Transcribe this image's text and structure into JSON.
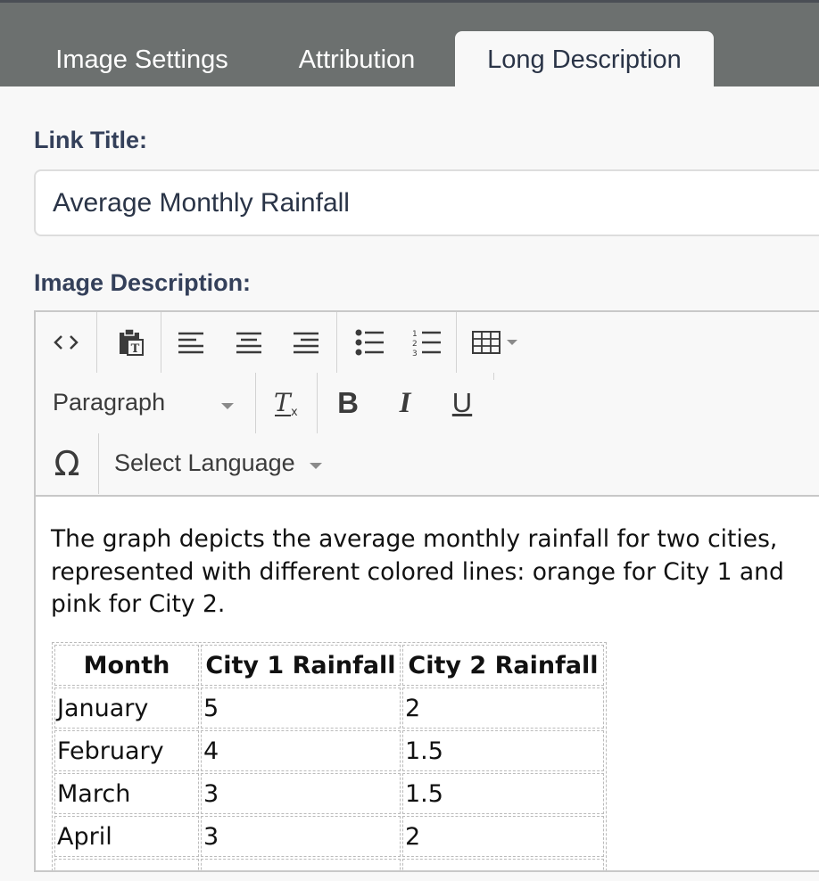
{
  "tabs": [
    {
      "label": "Image Settings",
      "active": false
    },
    {
      "label": "Attribution",
      "active": false
    },
    {
      "label": "Long Description",
      "active": true
    }
  ],
  "link_title": {
    "label": "Link Title:",
    "value": "Average Monthly Rainfall"
  },
  "image_description": {
    "label": "Image Description:"
  },
  "toolbar": {
    "format_select": "Paragraph",
    "language_select": "Select Language",
    "icons": [
      "source-code-icon",
      "paste-as-text-icon",
      "align-left-icon",
      "align-center-icon",
      "align-right-icon",
      "bullet-list-icon",
      "numbered-list-icon",
      "table-icon",
      "clear-formatting-icon",
      "bold-icon",
      "italic-icon",
      "underline-icon",
      "special-character-icon"
    ]
  },
  "content": {
    "paragraph": "The graph depicts the average monthly rainfall for two cities, represented with different colored lines: orange for City 1 and pink for City 2.",
    "table": {
      "headers": [
        "Month",
        "City 1 Rainfall",
        "City 2 Rainfall"
      ],
      "rows": [
        [
          "January",
          "5",
          "2"
        ],
        [
          "February",
          "4",
          "1.5"
        ],
        [
          "March",
          "3",
          "1.5"
        ],
        [
          "April",
          "3",
          "2"
        ],
        [
          "",
          "",
          ""
        ]
      ]
    }
  },
  "colors": {
    "tabbar_bg": "#6c706f",
    "label_text": "#34405a",
    "editor_border": "#c8c8c8"
  }
}
